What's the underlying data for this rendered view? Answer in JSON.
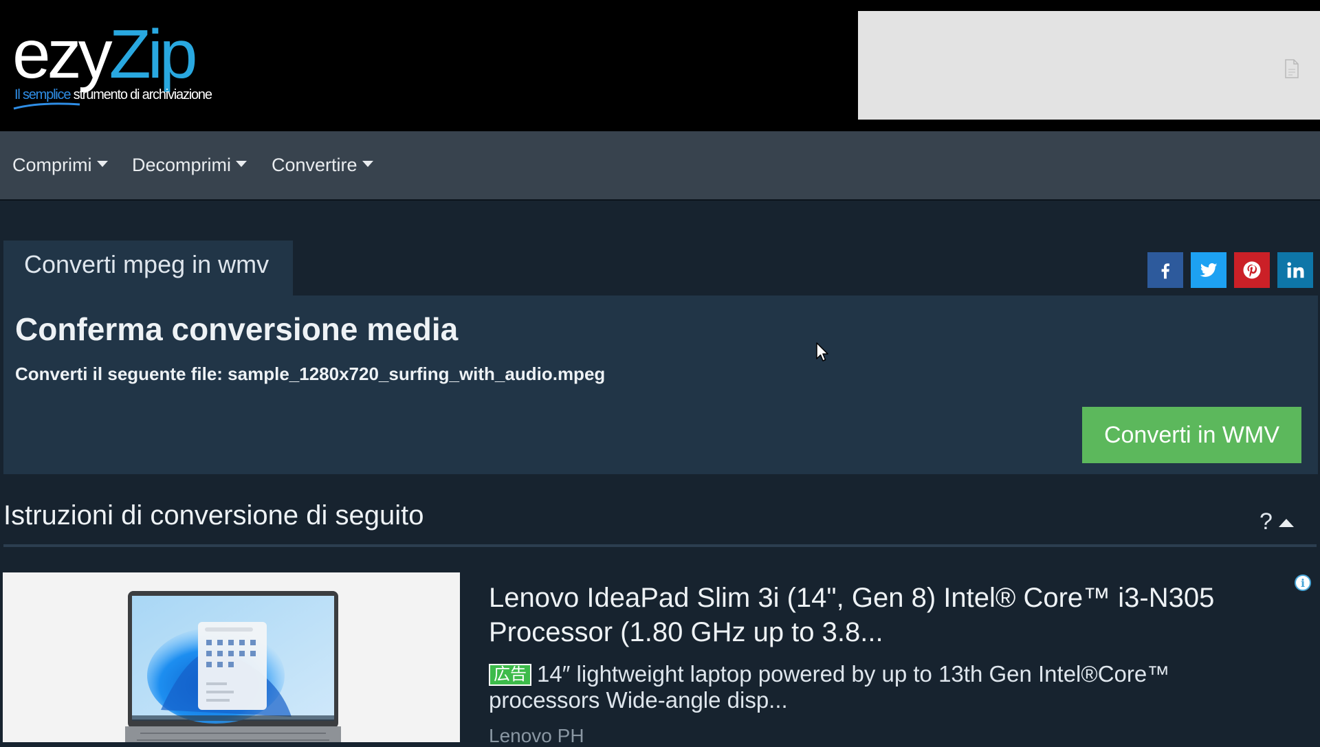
{
  "logo": {
    "part1": "ezy",
    "part2": "Zip",
    "tagline_highlight": "Il semplice",
    "tagline_rest": " strumento di archiviazione"
  },
  "nav": {
    "items": [
      {
        "label": "Comprimi"
      },
      {
        "label": "Decomprimi"
      },
      {
        "label": "Convertire"
      }
    ]
  },
  "tab": {
    "label": "Converti mpeg in wmv"
  },
  "social": {
    "icons": [
      "facebook-icon",
      "twitter-icon",
      "pinterest-icon",
      "linkedin-icon"
    ],
    "colors": {
      "facebook": "#2d5a9c",
      "twitter": "#1da1f2",
      "pinterest": "#cb2027",
      "linkedin": "#0e76a8"
    }
  },
  "card": {
    "title": "Conferma conversione media",
    "file_line": "Converti il seguente file: sample_1280x720_surfing_with_audio.mpeg",
    "button_label": "Converti in WMV"
  },
  "instructions": {
    "title": "Istruzioni di conversione di seguito",
    "help": "?"
  },
  "ad": {
    "title": "Lenovo IdeaPad Slim 3i (14\", Gen 8) Intel® Core™ i3-N305 Processor (1.80 GHz up to 3.8...",
    "badge": "広告",
    "description": "14″ lightweight laptop powered by up to 13th Gen Intel®Core™ processors Wide-angle disp...",
    "source": "Lenovo PH",
    "info": "i"
  },
  "colors": {
    "header_bg": "#000000",
    "nav_bg": "#38434e",
    "page_bg": "#17232f",
    "card_bg": "#213547",
    "accent_green": "#5cb85c",
    "logo_blue": "#29a8e0"
  }
}
